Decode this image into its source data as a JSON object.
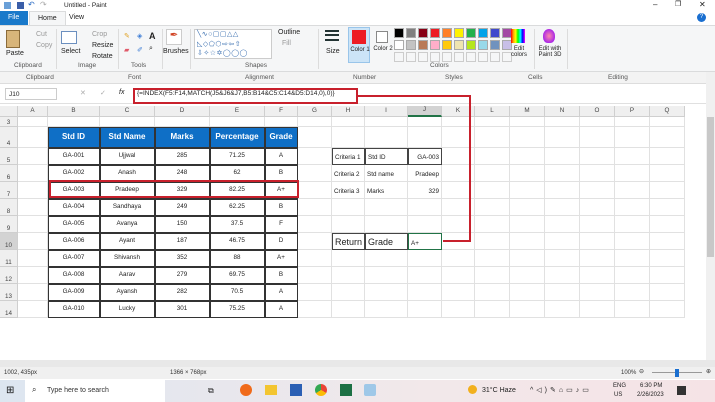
{
  "window": {
    "title": "Untitled - Paint",
    "tabs": [
      "File",
      "Home",
      "View"
    ]
  },
  "ribbon": {
    "clipboard": {
      "paste": "Paste",
      "cut": "Cut",
      "copy": "Copy",
      "label": "Clipboard"
    },
    "image": {
      "select": "Select",
      "crop": "Crop",
      "resize": "Resize",
      "rotate": "Rotate",
      "label": "Image"
    },
    "tools": {
      "label": "Tools"
    },
    "brushes": "Brushes",
    "shapes": {
      "outline": "Outline",
      "fill": "Fill",
      "label": "Shapes"
    },
    "size": "Size",
    "color1": "Color 1",
    "color2": "Color 2",
    "colors": {
      "label": "Colors",
      "edit": "Edit colors",
      "palette": [
        "#000000",
        "#7f7f7f",
        "#880015",
        "#ed1c24",
        "#ff7f27",
        "#fff200",
        "#22b14c",
        "#00a2e8",
        "#3f48cc",
        "#a349a4",
        "#ffffff",
        "#c3c3c3",
        "#b97a57",
        "#ffaec9",
        "#ffc90e",
        "#efe4b0",
        "#b5e61d",
        "#99d9ea",
        "#7092be",
        "#c8bfe7"
      ]
    },
    "paint3d": "Edit with Paint 3D"
  },
  "excel": {
    "groups": [
      "Clipboard",
      "Font",
      "Alignment",
      "Number",
      "Styles",
      "Cells",
      "Editing"
    ],
    "name_box": "J10",
    "formula": "{=INDEX(F5:F14,MATCH(J5&J6&J7,B5:B14&C5:C14&D5:D14,0),0)}",
    "columns": [
      "A",
      "B",
      "C",
      "D",
      "E",
      "F",
      "G",
      "H",
      "I",
      "J",
      "K",
      "L",
      "M",
      "N",
      "O",
      "P",
      "Q"
    ],
    "rows": [
      "3",
      "4",
      "5",
      "6",
      "7",
      "8",
      "9",
      "10",
      "11",
      "12",
      "13",
      "14"
    ],
    "table": {
      "headers": [
        "Std ID",
        "Std Name",
        "Marks",
        "Percentage",
        "Grade"
      ],
      "rows": [
        [
          "GA-001",
          "Ujjwal",
          "285",
          "71.25",
          "A"
        ],
        [
          "GA-002",
          "Anash",
          "248",
          "62",
          "B"
        ],
        [
          "GA-003",
          "Pradeep",
          "329",
          "82.25",
          "A+"
        ],
        [
          "GA-004",
          "Sandhaya",
          "249",
          "62.25",
          "B"
        ],
        [
          "GA-005",
          "Avanya",
          "150",
          "37.5",
          "F"
        ],
        [
          "GA-006",
          "Ayant",
          "187",
          "46.75",
          "D"
        ],
        [
          "GA-007",
          "Shivansh",
          "352",
          "88",
          "A+"
        ],
        [
          "GA-008",
          "Aarav",
          "279",
          "69.75",
          "B"
        ],
        [
          "GA-009",
          "Ayansh",
          "282",
          "70.5",
          "A"
        ],
        [
          "GA-010",
          "Lucky",
          "301",
          "75.25",
          "A"
        ]
      ]
    },
    "criteria": [
      [
        "Criteria 1",
        "Std ID",
        "GA-003"
      ],
      [
        "Criteria 2",
        "Std name",
        "Pradeep"
      ],
      [
        "Criteria 3",
        "Marks",
        "329"
      ]
    ],
    "result": [
      "Return",
      "Grade",
      "A+"
    ]
  },
  "status": {
    "position": "1002, 435px",
    "dimensions": "1366 × 768px",
    "zoom": "100%"
  },
  "taskbar": {
    "search": "Type here to search",
    "weather": "31°C  Haze",
    "lang1": "ENG",
    "lang2": "US",
    "time": "6:30 PM",
    "date": "2/26/2023"
  }
}
